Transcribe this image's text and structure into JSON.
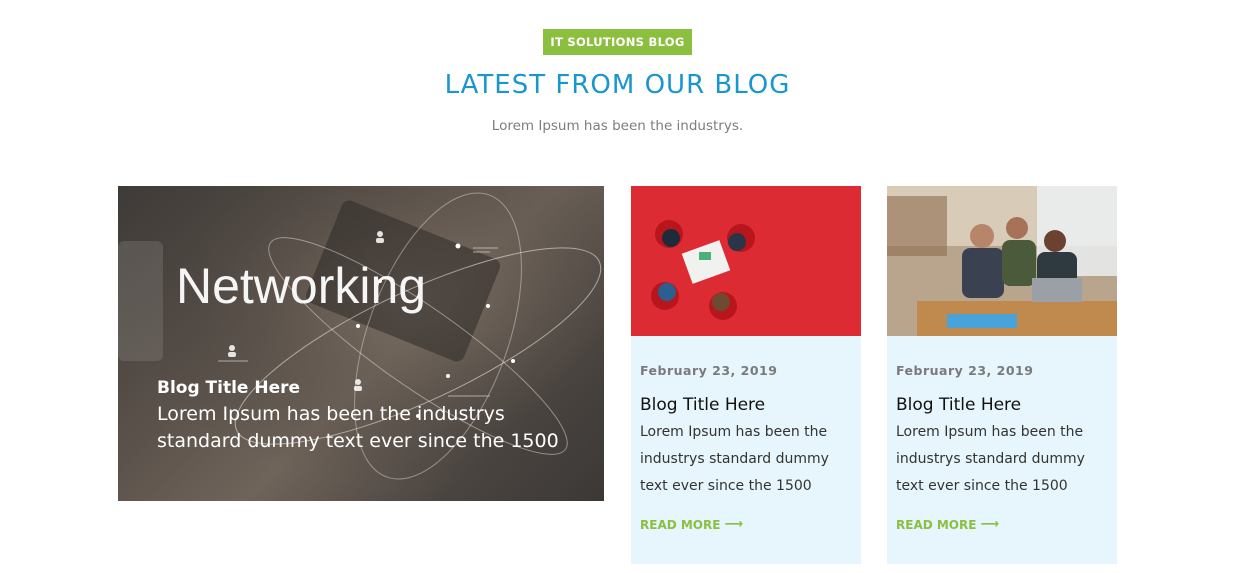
{
  "section": {
    "badge": "IT SOLUTIONS BLOG",
    "heading": "LATEST FROM OUR BLOG",
    "subheading": "Lorem Ipsum has been the industrys."
  },
  "featured": {
    "image_text": "Networking",
    "title": "Blog Title Here",
    "description": "Lorem Ipsum has been the industrys standard dummy text ever since the 1500"
  },
  "cards": [
    {
      "date": "February 23, 2019",
      "title": "Blog Title Here",
      "description": "Lorem Ipsum has been the industrys standard dummy text ever since the 1500",
      "read_more": "READ MORE",
      "arrow_icon": "long-arrow-right-icon"
    },
    {
      "date": "February 23, 2019",
      "title": "Blog Title Here",
      "description": "Lorem Ipsum has been the industrys standard dummy text ever since the 1500",
      "read_more": "READ MORE",
      "arrow_icon": "long-arrow-right-icon"
    }
  ],
  "colors": {
    "accent_green": "#8cbf3f",
    "heading_blue": "#1a96cf",
    "card_background": "#e6f6fc"
  }
}
